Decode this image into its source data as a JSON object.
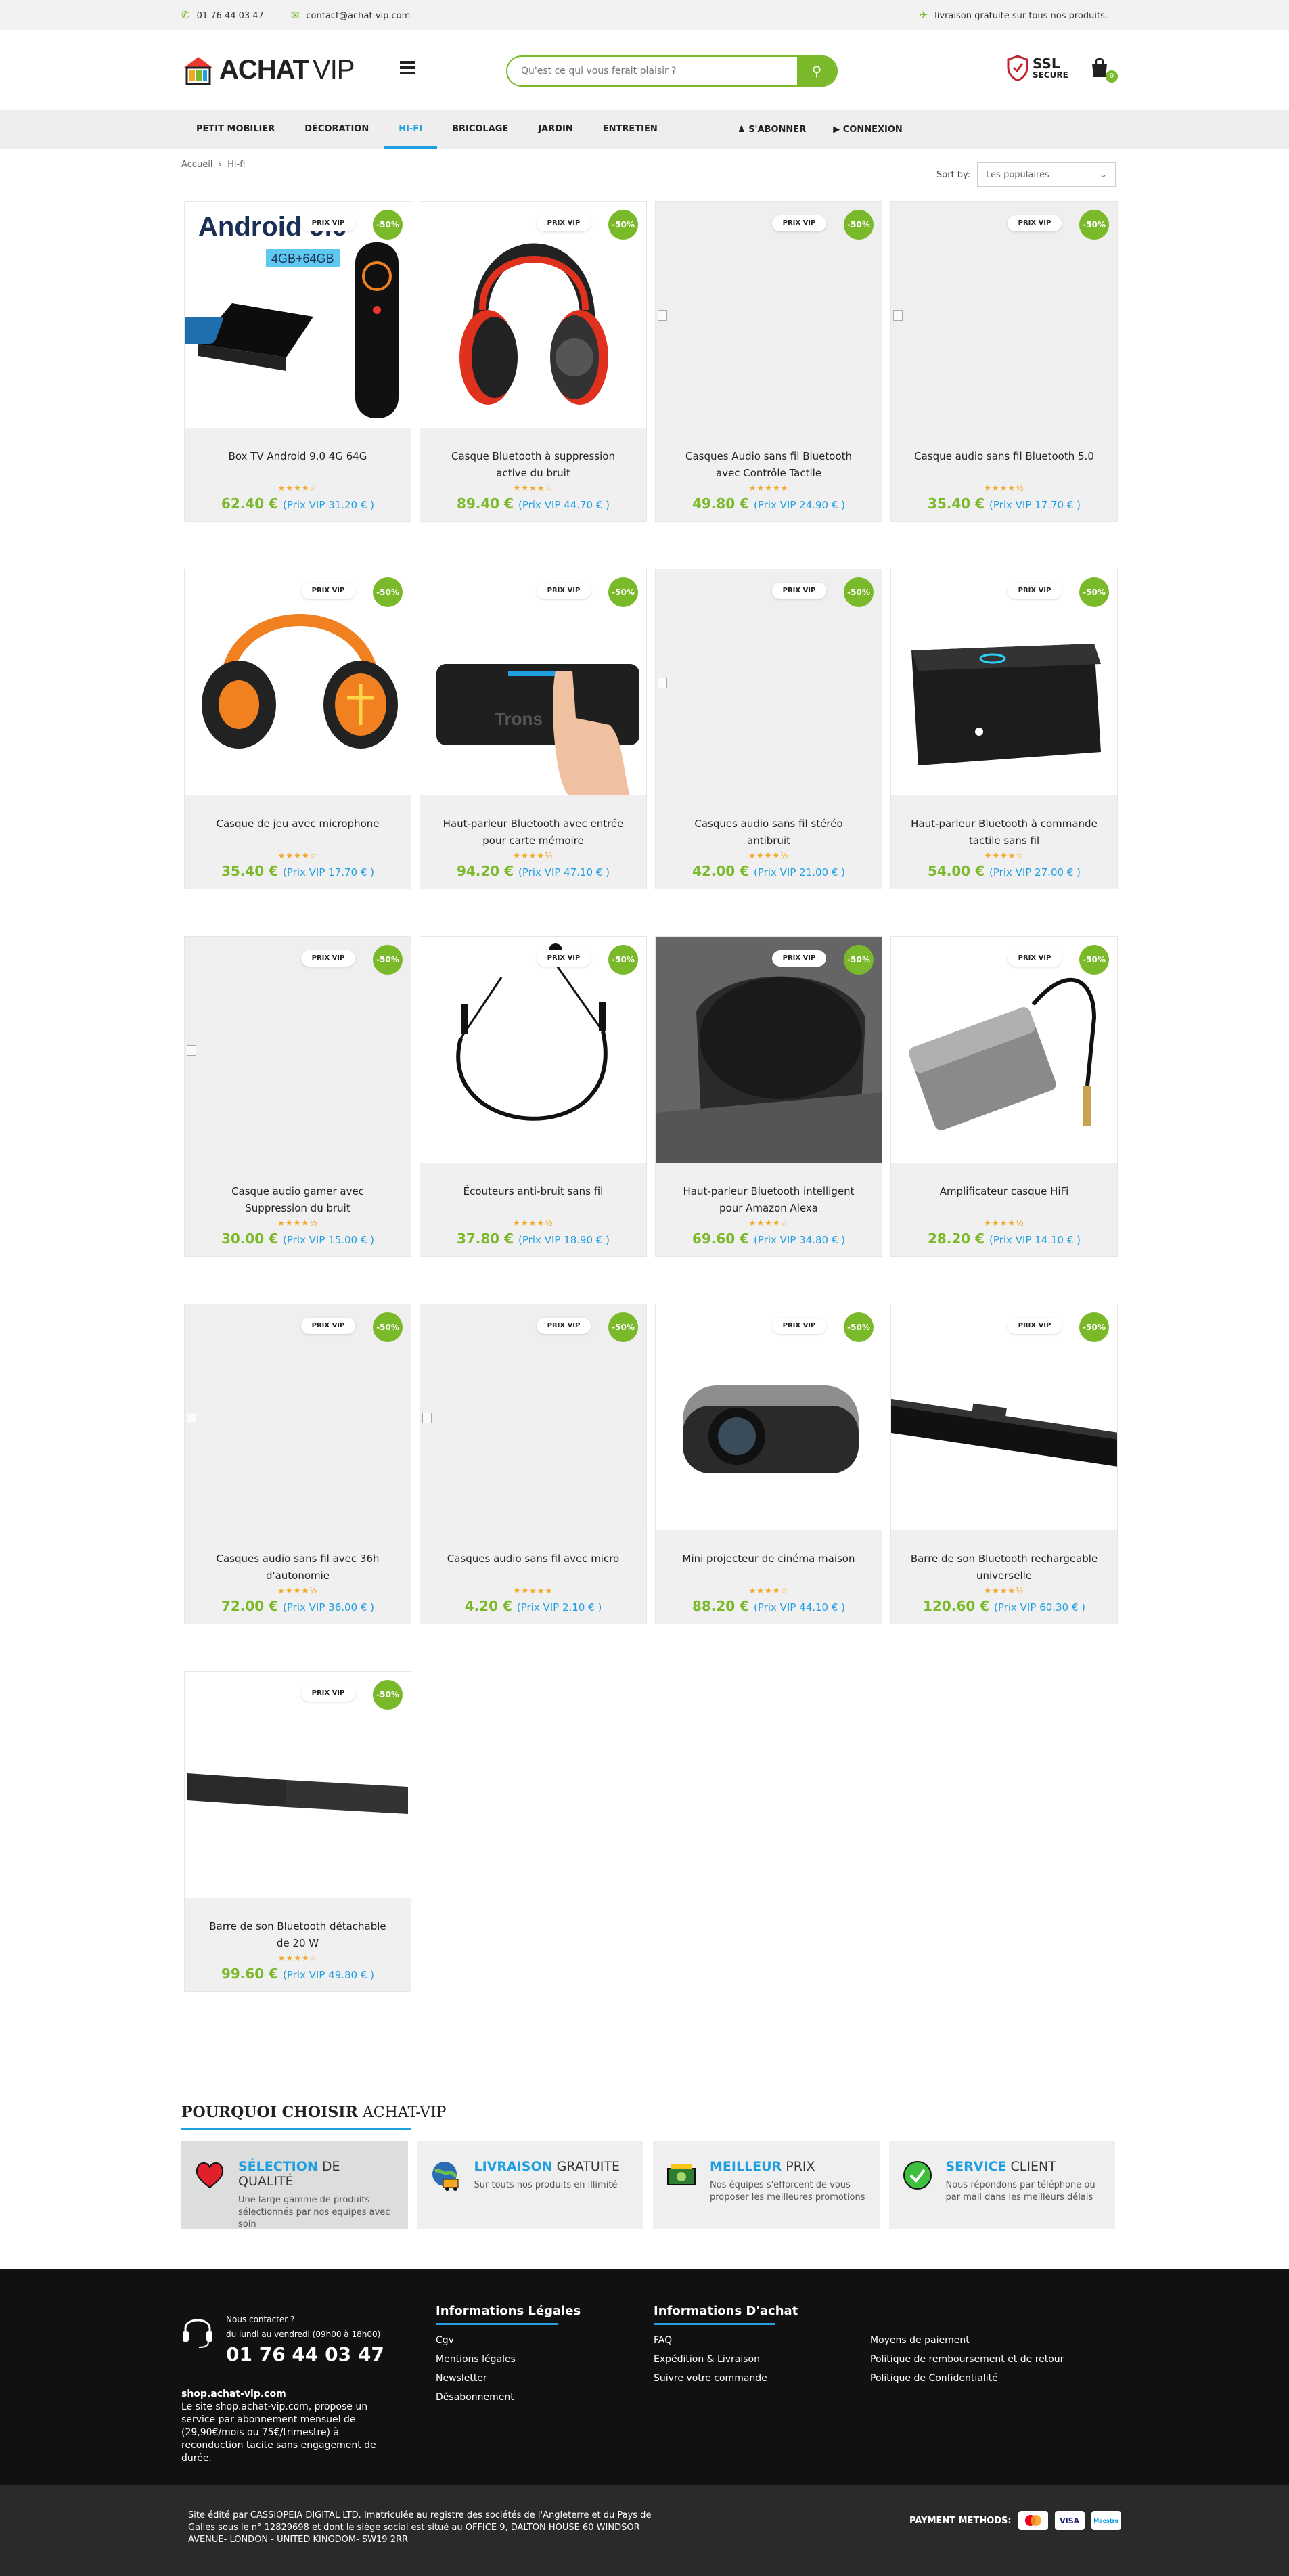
{
  "topbar": {
    "phone": "01 76 44 03 47",
    "email": "contact@achat-vip.com",
    "shipping": "livraison gratuite sur tous nos produits."
  },
  "logo": {
    "main": "ACHAT",
    "sub": "VIP"
  },
  "search": {
    "placeholder": "Qu'est ce qui vous ferait plaisir ?"
  },
  "ssl": {
    "line1": "SSL",
    "line2": "SECURE"
  },
  "cart": {
    "count": "0"
  },
  "nav": {
    "items": [
      "PETIT MOBILIER",
      "DÉCORATION",
      "HI-FI",
      "BRICOLAGE",
      "JARDIN",
      "ENTRETIEN"
    ],
    "active": "HI-FI",
    "subscribe": "S'ABONNER",
    "login": "CONNEXION"
  },
  "breadcrumb": {
    "home": "Accueil",
    "sep": "›",
    "current": "Hi-fi"
  },
  "sort": {
    "label": "Sort by:",
    "value": "Les populaires"
  },
  "badges": {
    "vip": "PRIX VIP",
    "discount": "-50%"
  },
  "products": [
    {
      "name": "Box TV Android 9.0 4G 64G",
      "price": "62.40 €",
      "vip": "(Prix VIP 31.20 € )",
      "stars": "★★★★☆",
      "img": "tvbox"
    },
    {
      "name": "Casque Bluetooth à suppression active du bruit",
      "price": "89.40 €",
      "vip": "(Prix VIP 44.70 € )",
      "stars": "★★★★☆",
      "img": "headphone-red"
    },
    {
      "name": "Casques Audio sans fil Bluetooth avec Contrôle Tactile",
      "price": "49.80 €",
      "vip": "(Prix VIP 24.90 € )",
      "stars": "★★★★★",
      "img": "broken"
    },
    {
      "name": "Casque audio sans fil Bluetooth 5.0",
      "price": "35.40 €",
      "vip": "(Prix VIP 17.70 € )",
      "stars": "★★★★½",
      "img": "broken"
    },
    {
      "name": "Casque de jeu avec microphone",
      "price": "35.40 €",
      "vip": "(Prix VIP 17.70 € )",
      "stars": "★★★★☆",
      "img": "gaming"
    },
    {
      "name": "Haut-parleur Bluetooth avec entrée pour carte mémoire",
      "price": "94.20 €",
      "vip": "(Prix VIP 47.10 € )",
      "stars": "★★★★½",
      "img": "speaker-hand"
    },
    {
      "name": "Casques audio sans fil stéréo antibruit",
      "price": "42.00 €",
      "vip": "(Prix VIP 21.00 € )",
      "stars": "★★★★½",
      "img": "broken"
    },
    {
      "name": "Haut-parleur Bluetooth à commande tactile sans fil",
      "price": "54.00 €",
      "vip": "(Prix VIP 27.00 € )",
      "stars": "★★★★☆",
      "img": "speaker-box"
    },
    {
      "name": "Casque audio gamer avec Suppression du bruit",
      "price": "30.00 €",
      "vip": "(Prix VIP 15.00 € )",
      "stars": "★★★★½",
      "img": "broken"
    },
    {
      "name": "Écouteurs anti-bruit sans fil",
      "price": "37.80 €",
      "vip": "(Prix VIP 18.90 € )",
      "stars": "★★★★½",
      "img": "earphones"
    },
    {
      "name": "Haut-parleur Bluetooth intelligent pour Amazon Alexa",
      "price": "69.60 €",
      "vip": "(Prix VIP 34.80 € )",
      "stars": "★★★★☆",
      "img": "pocket"
    },
    {
      "name": "Amplificateur casque HiFi",
      "price": "28.20 €",
      "vip": "(Prix VIP 14.10 € )",
      "stars": "★★★★½",
      "img": "amp"
    },
    {
      "name": "Casques audio sans fil avec 36h d'autonomie",
      "price": "72.00 €",
      "vip": "(Prix VIP 36.00 € )",
      "stars": "★★★★½",
      "img": "broken"
    },
    {
      "name": "Casques audio sans fil avec micro",
      "price": "4.20 €",
      "vip": "(Prix VIP 2.10 € )",
      "stars": "★★★★★",
      "img": "broken"
    },
    {
      "name": "Mini projecteur de cinéma maison",
      "price": "88.20 €",
      "vip": "(Prix VIP 44.10 € )",
      "stars": "★★★★☆",
      "img": "projector"
    },
    {
      "name": "Barre de son Bluetooth rechargeable universelle",
      "price": "120.60 €",
      "vip": "(Prix VIP 60.30 € )",
      "stars": "★★★★½",
      "img": "soundbar"
    },
    {
      "name": "Barre de son Bluetooth détachable de 20 W",
      "price": "99.60 €",
      "vip": "(Prix VIP 49.80 € )",
      "stars": "★★★★☆",
      "img": "soundbar2"
    }
  ],
  "why": {
    "title_bold": "Pourquoi choisir",
    "title_rest": "Achat-VIP",
    "boxes": [
      {
        "hl": "Sélection",
        "rest": " de qualité",
        "desc": "Une large gamme de produits sélectionnés par nos equipes avec soin",
        "icon": "heart-icon"
      },
      {
        "hl": "Livraison",
        "rest": " gratuite",
        "desc": "Sur touts nos produits en illimité",
        "icon": "globe-truck-icon"
      },
      {
        "hl": "Meilleur",
        "rest": " prix",
        "desc": "Nos équipes s'efforcent de vous proposer les meilleures promotions",
        "icon": "money-icon"
      },
      {
        "hl": "Service",
        "rest": " client",
        "desc": "Nous répondons par téléphone ou par mail dans les meilleurs délais",
        "icon": "check-icon"
      }
    ]
  },
  "footer": {
    "contact_q": "Nous contacter ?",
    "hours": "du lundi au vendredi (09h00 à 18h00)",
    "phone": "01 76 44 03 47",
    "site": "shop.achat-vip.com",
    "about": "Le site shop.achat-vip.com, propose un service par abonnement mensuel de (29,90€/mois ou 75€/trimestre) à reconduction tacite sans engagement de durée.",
    "legal_title": "Informations Légales",
    "legal_links": [
      "Cgv",
      "Mentions légales",
      "Newsletter",
      "Désabonnement"
    ],
    "buy_title": "Informations D'achat",
    "buy_col1": [
      "FAQ",
      "Expédition & Livraison",
      "Suivre votre commande"
    ],
    "buy_col2": [
      "Moyens de paiement",
      "Politique de remboursement et de retour",
      "Politique de Confidentialité"
    ]
  },
  "bottom": {
    "legal": "Site édité par CASSIOPEIA DIGITAL LTD. Imatriculée au registre des sociétés de l'Angleterre et du Pays de Galles sous le n° 12829698 et dont le siège social est situé au OFFICE 9, DALTON HOUSE 60 WINDSOR AVENUE- LONDON - UNITED KINGDOM- SW19 2RR",
    "payment_label": "PAYMENT METHODS:",
    "methods": [
      "mastercard",
      "VISA",
      "Maestro"
    ]
  },
  "colors": {
    "green": "#7ab929",
    "blue": "#1f9ee0",
    "footer": "#111111"
  }
}
